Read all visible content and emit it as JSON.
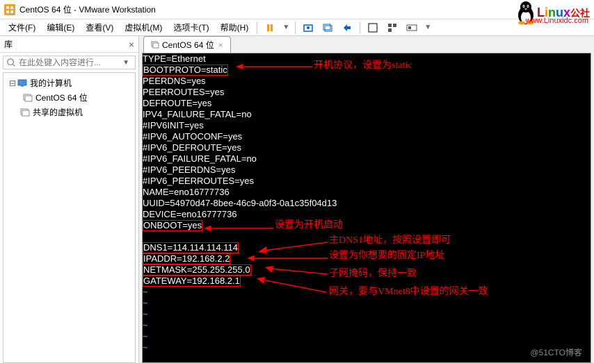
{
  "window": {
    "title": "CentOS 64 位 - VMware Workstation"
  },
  "menu": {
    "file": "文件(F)",
    "edit": "编辑(E)",
    "view": "查看(V)",
    "vm": "虚拟机(M)",
    "tabs": "选项卡(T)",
    "help": "帮助(H)"
  },
  "sidebar": {
    "title": "库",
    "search_placeholder": "在此处键入内容进行...",
    "tree": {
      "root": "我的计算机",
      "vm": "CentOS 64 位",
      "shared": "共享的虚拟机"
    }
  },
  "tab": {
    "label": "CentOS 64 位"
  },
  "terminal": {
    "lines": [
      "TYPE=Ethernet",
      "BOOTPROTO=static",
      "PEERDNS=yes",
      "PEERROUTES=yes",
      "DEFROUTE=yes",
      "IPV4_FAILURE_FATAL=no",
      "#IPV6INIT=yes",
      "#IPV6_AUTOCONF=yes",
      "#IPV6_DEFROUTE=yes",
      "#IPV6_FAILURE_FATAL=no",
      "#IPV6_PEERDNS=yes",
      "#IPV6_PEERROUTES=yes",
      "NAME=eno16777736",
      "UUID=54970d47-8bee-46c9-a0f3-0a1c35f04d13",
      "DEVICE=eno16777736",
      "ONBOOT=yes",
      "",
      "DNS1=114.114.114.114",
      "IPADDR=192.168.2.2",
      "NETMASK=255.255.255.0",
      "GATEWAY=192.168.2.1"
    ]
  },
  "annotations": {
    "bootproto": "开机协议，设置为static",
    "onboot": "设置为开机启动",
    "dns1": "主DNS1地址，按照设置即可",
    "ipaddr": "设置为你想要的固定IP地址",
    "netmask": "子网掩码，保持一致",
    "gateway": "网关，要与VMnet8中设置的网关一致"
  },
  "watermark": "@51CTO博客",
  "logo": {
    "text": "Linux",
    "sub": "公社",
    "url": "www.Linuxidc.com"
  }
}
